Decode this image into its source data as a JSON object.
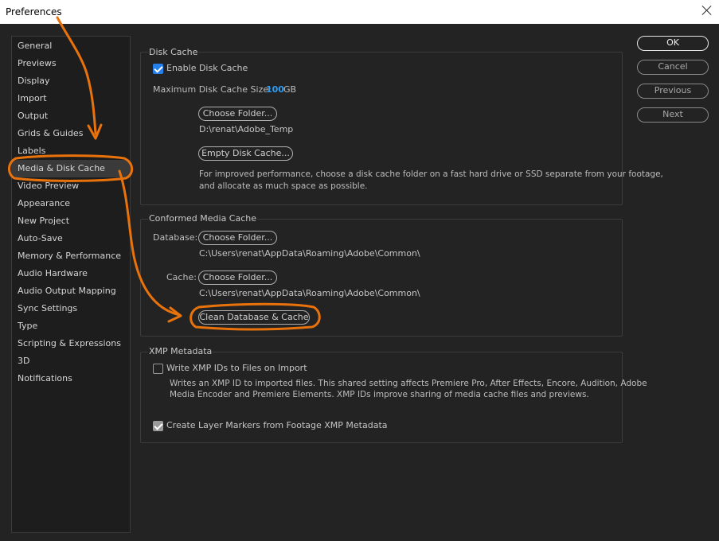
{
  "window": {
    "title": "Preferences"
  },
  "sidebar": {
    "items": [
      "General",
      "Previews",
      "Display",
      "Import",
      "Output",
      "Grids & Guides",
      "Labels",
      "Media & Disk Cache",
      "Video Preview",
      "Appearance",
      "New Project",
      "Auto-Save",
      "Memory & Performance",
      "Audio Hardware",
      "Audio Output Mapping",
      "Sync Settings",
      "Type",
      "Scripting & Expressions",
      "3D",
      "Notifications"
    ],
    "active": "Media & Disk Cache"
  },
  "disk_cache": {
    "title": "Disk Cache",
    "enable_label": "Enable Disk Cache",
    "enable_checked": true,
    "max_size_label": "Maximum Disk Cache Size:",
    "max_size_value": "100",
    "max_size_unit": "GB",
    "choose_folder": "Choose Folder...",
    "folder_path": "D:\\renat\\Adobe_Temp",
    "empty_cache": "Empty Disk Cache...",
    "info_line1": "For improved performance, choose a disk cache folder on a fast hard drive or SSD separate from your footage,",
    "info_line2": "and allocate as much space as possible."
  },
  "conformed": {
    "title": "Conformed Media Cache",
    "database_label": "Database:",
    "database_button": "Choose Folder...",
    "database_path": "C:\\Users\\renat\\AppData\\Roaming\\Adobe\\Common\\",
    "cache_label": "Cache:",
    "cache_button": "Choose Folder...",
    "cache_path": "C:\\Users\\renat\\AppData\\Roaming\\Adobe\\Common\\",
    "clean_button": "Clean Database & Cache"
  },
  "xmp": {
    "title": "XMP Metadata",
    "write_label": "Write XMP IDs to Files on Import",
    "write_checked": false,
    "write_desc_line1": "Writes an XMP ID to imported files. This shared setting affects Premiere Pro, After Effects, Encore, Audition, Adobe",
    "write_desc_line2": "Media Encoder and Premiere Elements. XMP IDs improve sharing of media cache files and previews.",
    "layer_markers_label": "Create Layer Markers from Footage XMP Metadata",
    "layer_markers_checked": true
  },
  "dialog_buttons": {
    "ok": "OK",
    "cancel": "Cancel",
    "previous": "Previous",
    "next": "Next"
  },
  "annotation_color": "#e8720c"
}
